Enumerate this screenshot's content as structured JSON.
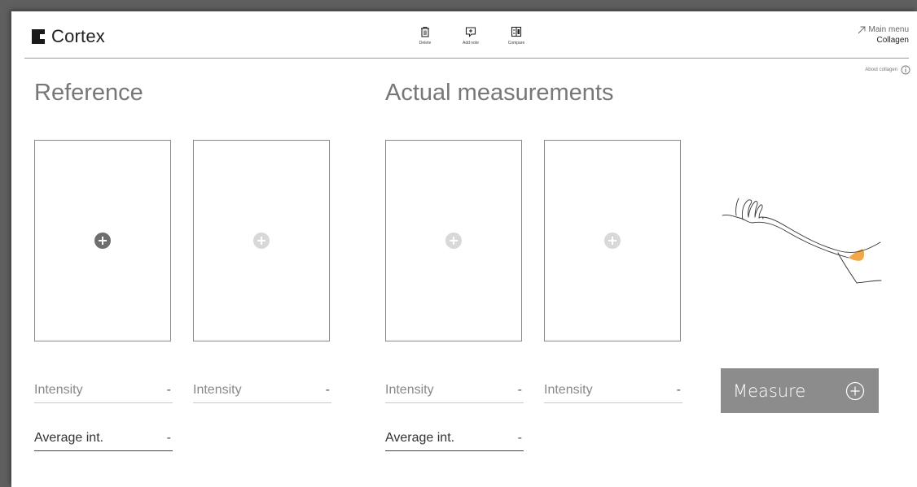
{
  "header": {
    "logo_text": "Cortex",
    "toolbar": [
      {
        "label": "Delete",
        "icon": "trash-icon"
      },
      {
        "label": "Add note",
        "icon": "add-note-icon"
      },
      {
        "label": "Compare",
        "icon": "compare-icon"
      }
    ],
    "main_menu_label": "Main menu",
    "app_name": "Collagen",
    "about_label": "About collagen"
  },
  "reference": {
    "title": "Reference",
    "slots": [
      {
        "intensity_label": "Intensity",
        "intensity_value": "-",
        "active": true
      },
      {
        "intensity_label": "Intensity",
        "intensity_value": "-",
        "active": false
      }
    ],
    "average_label": "Average int.",
    "average_value": "-"
  },
  "actual": {
    "title": "Actual measurements",
    "slots": [
      {
        "intensity_label": "Intensity",
        "intensity_value": "-",
        "active": false
      },
      {
        "intensity_label": "Intensity",
        "intensity_value": "-",
        "active": false
      }
    ],
    "average_label": "Average int.",
    "average_value": "-"
  },
  "measure": {
    "label": "Measure",
    "icon": "plus-circle-icon"
  },
  "colors": {
    "accent": "#f0a848",
    "button_bg": "#8c8c8c",
    "active_plus": "#6e6e6e",
    "inactive_plus": "#d8d8d8"
  }
}
